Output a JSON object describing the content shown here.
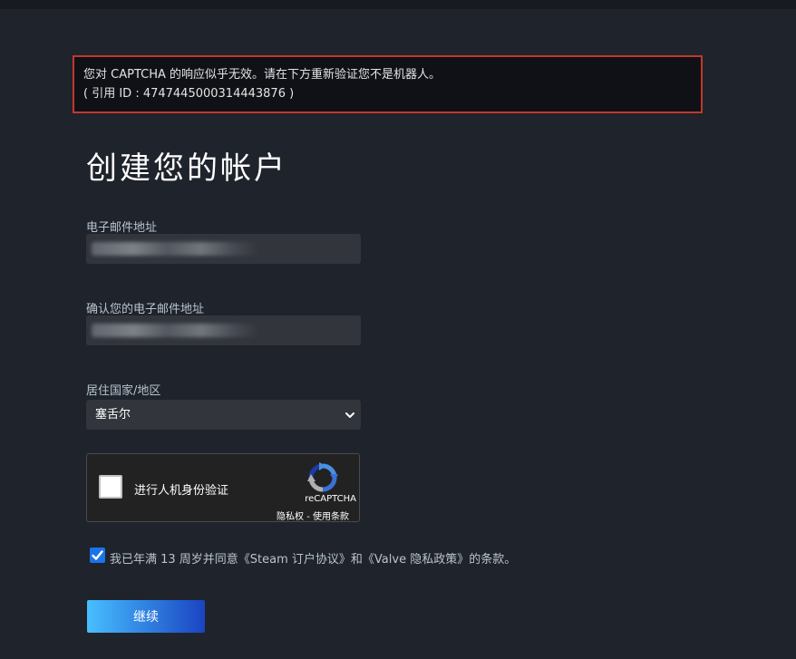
{
  "error": {
    "line1": "您对 CAPTCHA 的响应似乎无效。请在下方重新验证您不是机器人。",
    "line2": "( 引用 ID : 4747445000314443876 )"
  },
  "page_title": "创建您的帐户",
  "email": {
    "label": "电子邮件地址",
    "value": "",
    "redacted": true
  },
  "confirm_email": {
    "label": "确认您的电子邮件地址",
    "value": "",
    "redacted": true
  },
  "country": {
    "label": "居住国家/地区",
    "selected": "塞舌尔"
  },
  "recaptcha": {
    "checkbox_label": "进行人机身份验证",
    "brand": "reCAPTCHA",
    "privacy_link": "隐私权",
    "separator": " - ",
    "terms_link": "使用条款",
    "checked": false
  },
  "agreement": {
    "checked": true,
    "text": "我已年满 13 周岁并同意《Steam 订户协议》和《Valve 隐私政策》的条款。"
  },
  "continue_button": "继续",
  "colors": {
    "background": "#1f232b",
    "error_border": "#c0392b",
    "input_bg": "#32353c",
    "button_start": "#47bfff",
    "button_end": "#1a44c2"
  }
}
